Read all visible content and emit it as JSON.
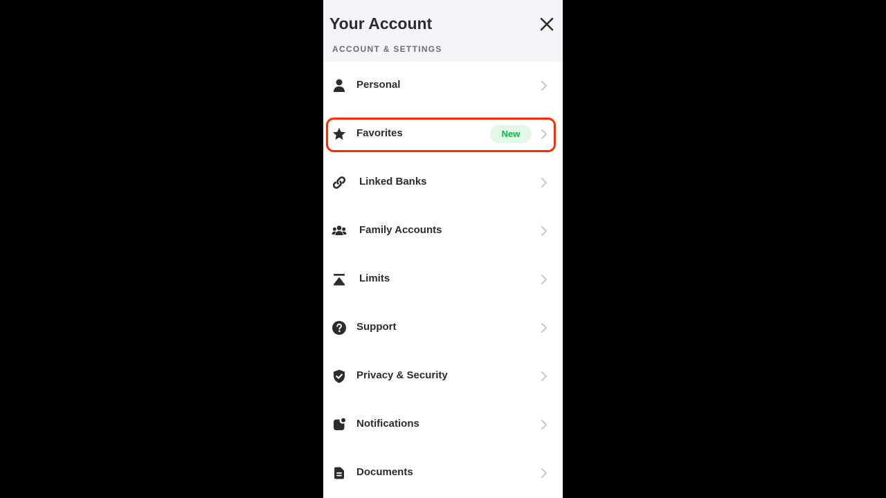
{
  "header": {
    "title": "Your Account",
    "subtitle": "ACCOUNT & SETTINGS",
    "close_icon": "close-icon"
  },
  "menu": {
    "items": [
      {
        "label": "Personal",
        "icon": "person-icon"
      },
      {
        "label": "Favorites",
        "icon": "star-icon",
        "badge": "New"
      },
      {
        "label": "Linked Banks",
        "icon": "link-icon"
      },
      {
        "label": "Family Accounts",
        "icon": "family-icon"
      },
      {
        "label": "Limits",
        "icon": "limits-icon"
      },
      {
        "label": "Support",
        "icon": "help-icon"
      },
      {
        "label": "Privacy & Security",
        "icon": "shield-icon"
      },
      {
        "label": "Notifications",
        "icon": "notification-icon"
      },
      {
        "label": "Documents",
        "icon": "document-icon"
      }
    ]
  },
  "colors": {
    "background": "#000000",
    "header_bg": "#f4f4f6",
    "text": "#2c2c2e",
    "badge_bg": "#e3f7e9",
    "badge_text": "#00c244",
    "highlight": "#ff2a00"
  }
}
